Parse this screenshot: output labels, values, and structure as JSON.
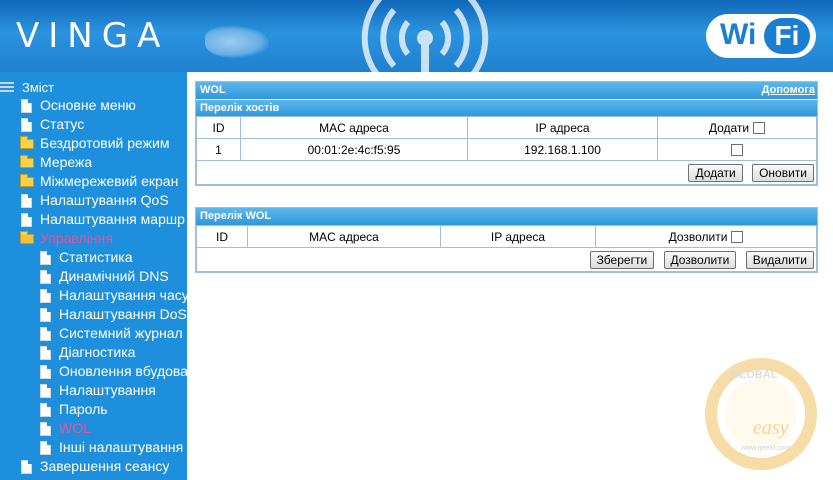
{
  "header": {
    "brand": "VINGA",
    "wifi_logo": "Wi Fi",
    "wifi_left": "Wi",
    "wifi_right": "Fi"
  },
  "sidebar": {
    "root_label": "Зміст",
    "items": [
      {
        "label": "Основне меню",
        "icon": "page-icon"
      },
      {
        "label": "Статус",
        "icon": "page-icon"
      },
      {
        "label": "Бездротовий режим",
        "icon": "folder-icon"
      },
      {
        "label": "Мережа",
        "icon": "folder-icon"
      },
      {
        "label": "Міжмережевий екран",
        "icon": "folder-icon"
      },
      {
        "label": "Налаштування QoS",
        "icon": "page-icon"
      },
      {
        "label": "Налаштування маршр",
        "icon": "page-icon"
      },
      {
        "label": "Управління",
        "icon": "folder-open-icon"
      },
      {
        "label": "Статистика",
        "icon": "page-icon"
      },
      {
        "label": "Динамічний DNS",
        "icon": "page-icon"
      },
      {
        "label": "Налаштування часу",
        "icon": "page-icon"
      },
      {
        "label": "Налаштування DoS",
        "icon": "page-icon"
      },
      {
        "label": "Системний журнал",
        "icon": "page-icon"
      },
      {
        "label": "Діагностика",
        "icon": "page-icon"
      },
      {
        "label": "Оновлення вбудова",
        "icon": "page-icon"
      },
      {
        "label": "Налаштування",
        "icon": "page-icon"
      },
      {
        "label": "Пароль",
        "icon": "page-icon"
      },
      {
        "label": "WOL",
        "icon": "page-icon"
      },
      {
        "label": "Інші налаштування",
        "icon": "page-icon"
      },
      {
        "label": "Завершення сеансу",
        "icon": "page-icon"
      }
    ],
    "active_color": "#f04fa0"
  },
  "main": {
    "title": "WOL",
    "help_link": "Допомога",
    "hosts": {
      "section_title": "Перелік хостів",
      "columns": [
        "ID",
        "MAC адреса",
        "IP адреса",
        "Додати"
      ],
      "rows": [
        {
          "id": "1",
          "mac": "00:01:2e:4c:f5:95",
          "ip": "192.168.1.100"
        }
      ],
      "buttons": {
        "add": "Додати",
        "refresh": "Оновити"
      }
    },
    "wol": {
      "section_title": "Перелік WOL",
      "columns": [
        "ID",
        "MAC адреса",
        "IP адреса",
        "Дозволити"
      ],
      "buttons": {
        "save": "Зберегти",
        "allow": "Дозволити",
        "delete": "Видалити"
      }
    }
  },
  "watermark": {
    "text_top": "GLOBAL",
    "text_mid": "easy",
    "url": "www.geeld.com"
  },
  "colors": {
    "header_bg": "#1f80cf",
    "sidebar_bg": "#1e8fdc",
    "panel_header": "#2f98dc",
    "border": "#9bbfdc"
  }
}
